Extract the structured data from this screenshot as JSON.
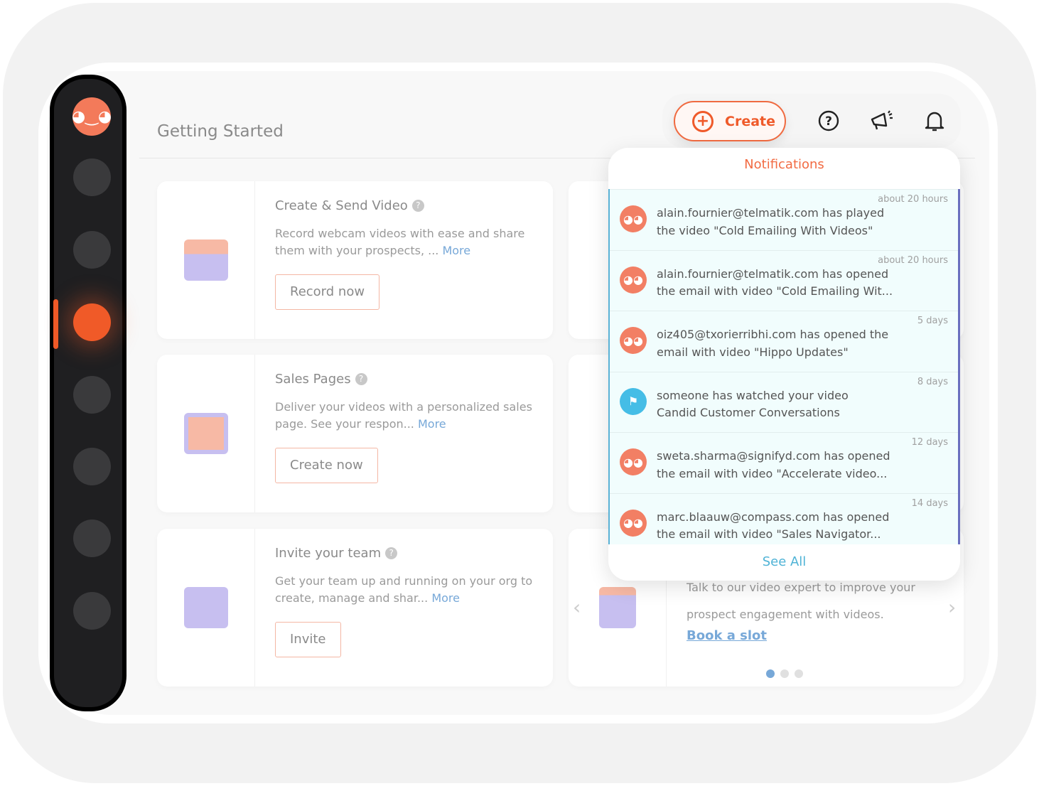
{
  "header": {
    "title": "Getting Started",
    "create_label": "Create"
  },
  "top_icons": [
    "help-circle-icon",
    "megaphone-icon",
    "bell-icon"
  ],
  "sidebar": {
    "active_index": 3,
    "item_count": 7
  },
  "cards": [
    {
      "title": "Create & Send Video",
      "desc": "Record webcam videos with ease and share them with your prospects, ... ",
      "more": "More",
      "button": "Record now",
      "icon": "clapperboard-icon"
    },
    {
      "title": "Sales Pages",
      "desc": "Deliver your videos with a personalized sales page. See your respon... ",
      "more": "More",
      "button": "Create now",
      "icon": "monitor-play-icon"
    },
    {
      "title": "Invite your team",
      "desc": "Get your team up and running on your org to create, manage and shar... ",
      "more": "More",
      "button": "Invite",
      "icon": "envelope-person-icon"
    }
  ],
  "expert_card": {
    "text_line1": "Talk to our video expert to improve your",
    "text_line2": "prospect engagement with videos.",
    "link": "Book a slot",
    "carousel_pages": 3,
    "carousel_active": 1
  },
  "notifications": {
    "title": "Notifications",
    "see_all": "See All",
    "items": [
      {
        "line1": "alain.fournier@telmatik.com has played",
        "line2": "the video \"Cold Emailing With Videos\"",
        "time": "about 20 hours",
        "avatar": "hippo"
      },
      {
        "line1": "alain.fournier@telmatik.com has opened",
        "line2": "the email with video \"Cold Emailing Wit...",
        "time": "about 20 hours",
        "avatar": "hippo"
      },
      {
        "line1": "oiz405@txorierribhi.com has opened the",
        "line2": "email with video \"Hippo Updates\"",
        "time": "5 days",
        "avatar": "hippo"
      },
      {
        "line1": "someone has watched your video",
        "line2": "Candid Customer Conversations",
        "time": "8 days",
        "avatar": "flag"
      },
      {
        "line1": "sweta.sharma@signifyd.com has opened",
        "line2": "the email with video \"Accelerate video...",
        "time": "12 days",
        "avatar": "hippo"
      },
      {
        "line1": "marc.blaauw@compass.com has opened",
        "line2": "the email with video \"Sales Navigator...",
        "time": "14 days",
        "avatar": "hippo"
      }
    ]
  },
  "colors": {
    "accent": "#f05a28",
    "link": "#77a8d8",
    "see_all": "#4fb3d6"
  }
}
